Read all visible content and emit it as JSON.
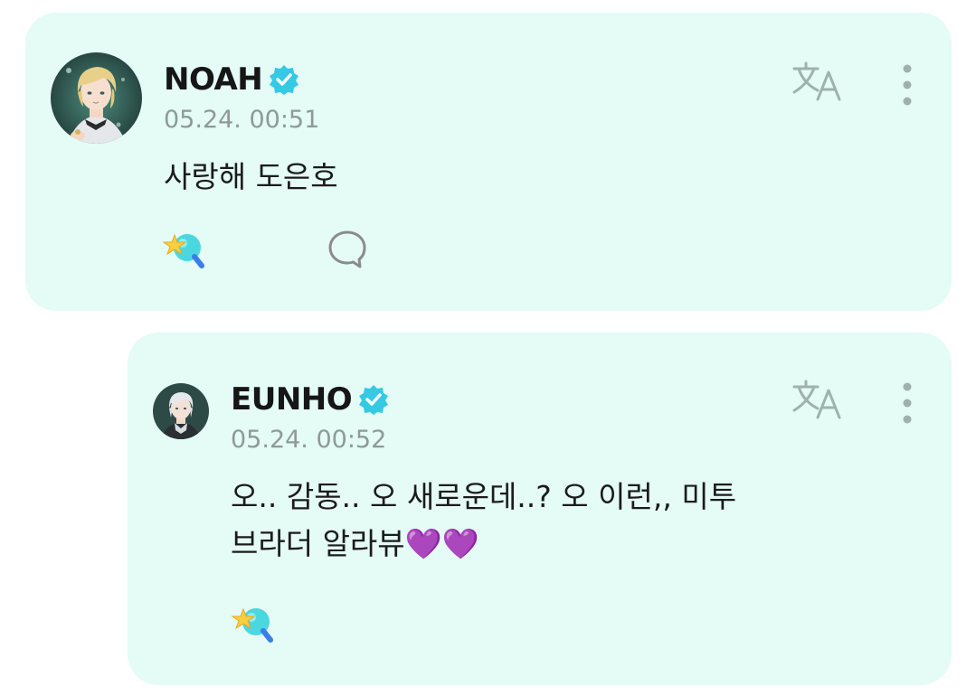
{
  "posts": [
    {
      "author": "NOAH",
      "timestamp": "05.24. 00:51",
      "message": "사랑해 도은호",
      "verified": true,
      "avatar": "blond-haired-character-avatar"
    },
    {
      "author": "EUNHO",
      "timestamp": "05.24. 00:52",
      "message_line1": "오.. 감동.. 오 새로운데..? 오 이런,, 미투",
      "message_line2": "브라더 알라뷰💜💜",
      "verified": true,
      "avatar": "silver-haired-character-avatar"
    }
  ],
  "icons": {
    "verified": "verified-badge-icon",
    "translate": "translate-icon",
    "more": "more-vertical-icon",
    "react": "star-wand-reaction-icon",
    "comment": "comment-bubble-icon"
  },
  "colors": {
    "card_background": "#e4fbf6",
    "verified_badge": "#35c9e4",
    "timestamp": "#8e9a98",
    "icon_gray": "#9fb1ae",
    "heart_purple": "#b12de6"
  }
}
